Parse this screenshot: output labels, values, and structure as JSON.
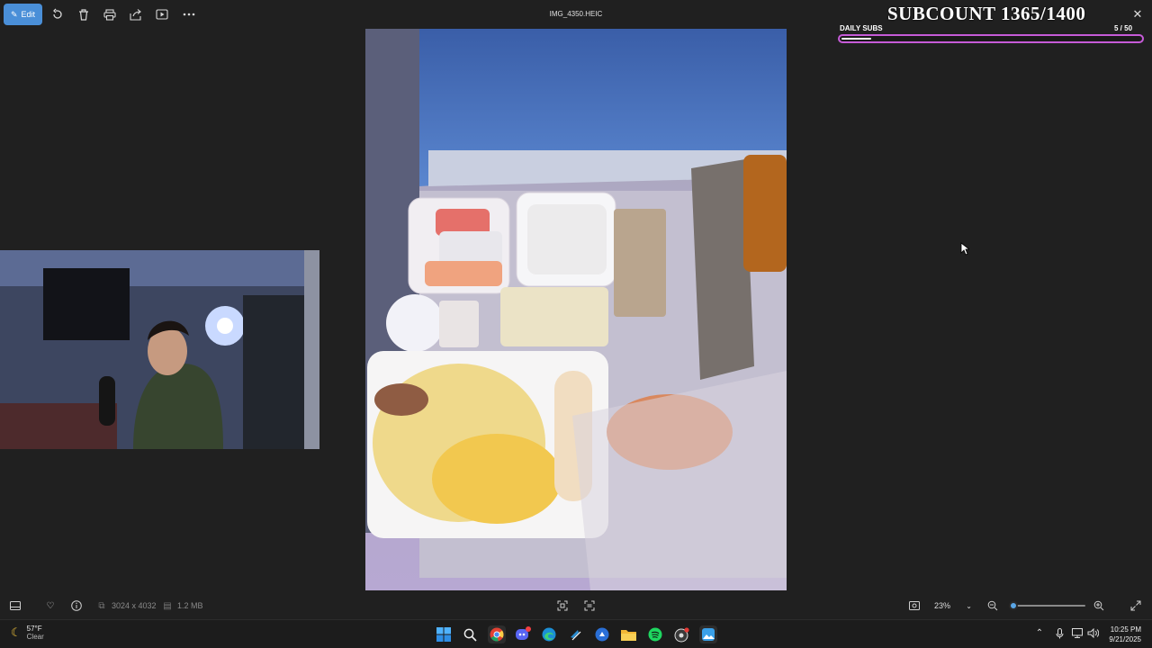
{
  "window": {
    "title": "IMG_4350.HEIC"
  },
  "toolbar": {
    "edit_label": "Edit",
    "icons": [
      "rotate-icon",
      "delete-icon",
      "print-icon",
      "share-icon",
      "slideshow-icon",
      "more-icon"
    ]
  },
  "overlay": {
    "subcount": "SUBCOUNT 1365/1400",
    "daily_label": "DAILY SUBS",
    "daily_count": "5 / 50",
    "daily_progress": 0.1,
    "bar_color": "#c65bd8"
  },
  "bottom": {
    "dimensions": "3024 x 4032",
    "size": "1.2 MB",
    "zoom": "23%",
    "zoom_level": 0.03
  },
  "taskbar": {
    "temperature": "57°F",
    "condition": "Clear",
    "time": "10:25 PM",
    "date": "9/21/2025",
    "apps": [
      "windows-start-icon",
      "search-icon",
      "chrome-icon",
      "discord-icon",
      "edge-icon",
      "steam-icon",
      "app-icon",
      "file-explorer-icon",
      "spotify-icon",
      "obs-icon",
      "photos-icon"
    ]
  },
  "colors": {
    "accent": "#4a8fd8",
    "background": "#202020"
  }
}
